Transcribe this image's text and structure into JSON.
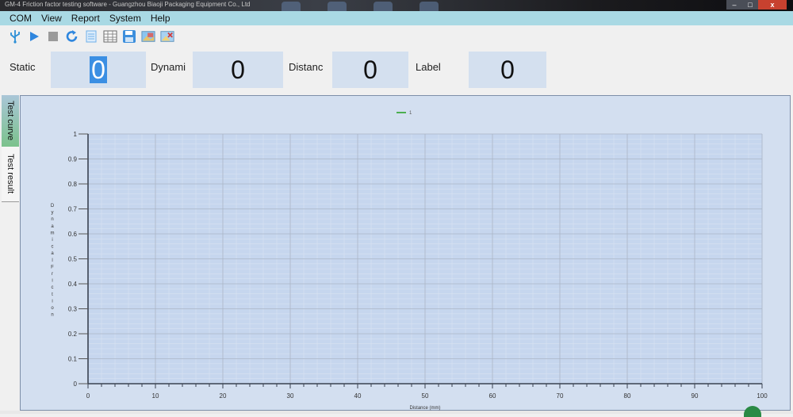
{
  "window": {
    "title": "GM-4  Friction factor testing software - Guangzhou Biaoji Packaging Equipment Co., Ltd",
    "controls": {
      "minimize": "–",
      "maximize": "□",
      "close": "x"
    }
  },
  "menu": {
    "items": [
      "COM",
      "View",
      "Report",
      "System",
      "Help"
    ]
  },
  "toolbar": {
    "icons": [
      "usb-icon",
      "play-icon",
      "stop-icon",
      "refresh-icon",
      "list-icon",
      "table-icon",
      "save-icon",
      "export-image-icon",
      "clear-image-icon"
    ]
  },
  "readouts": {
    "static": {
      "label": "Static",
      "value": "0"
    },
    "dynamic": {
      "label": "Dynami",
      "value": "0"
    },
    "distance": {
      "label": "Distanc",
      "value": "0"
    },
    "label": {
      "label": "Label",
      "value": "0"
    }
  },
  "sidetabs": {
    "test_curve": "Test curve",
    "test_result": "Test result"
  },
  "colors": {
    "menubar": "#a9d9e4",
    "plot_bg": "#c6d6ee",
    "panel_bg": "#d3dff0",
    "series": "#4caf50",
    "selection": "#3b8fe3"
  },
  "chart_data": {
    "type": "line",
    "title": "",
    "legend": [
      {
        "name": "1",
        "color": "#4caf50"
      }
    ],
    "legend_position": "top-center",
    "xlabel": "Distance (mm)",
    "ylabel": "DynamicalFriction",
    "xlim": [
      0,
      100
    ],
    "ylim": [
      0,
      1
    ],
    "xticks": [
      "0",
      "10",
      "20",
      "30",
      "40",
      "50",
      "60",
      "70",
      "80",
      "90",
      "100"
    ],
    "yticks": [
      "0",
      "0.1",
      "0.2",
      "0.3",
      "0.4",
      "0.5",
      "0.6",
      "0.7",
      "0.8",
      "0.9",
      "1"
    ],
    "x_minor_step": 2,
    "grid": true,
    "series": [
      {
        "name": "1",
        "x": [],
        "y": []
      }
    ]
  }
}
